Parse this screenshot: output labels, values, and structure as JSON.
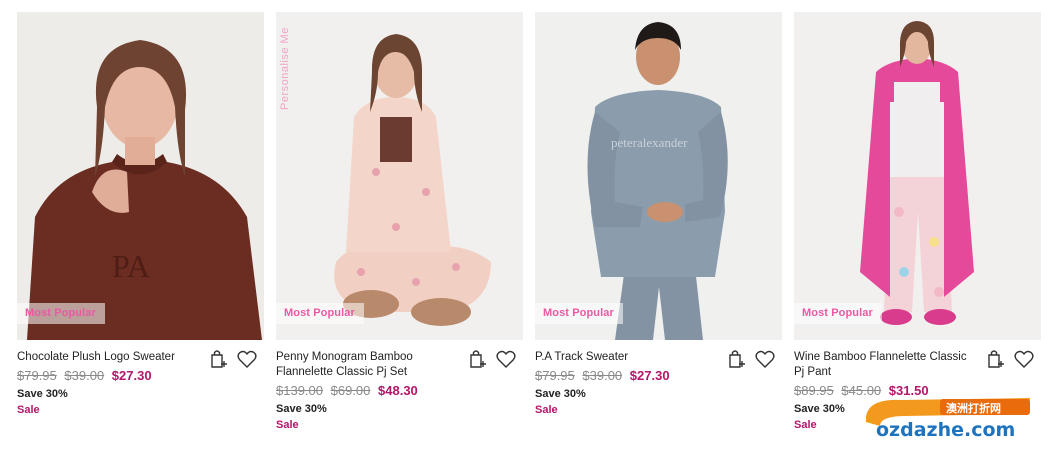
{
  "products": [
    {
      "name": "Chocolate Plush Logo Sweater",
      "badge": "Most Popular",
      "prices": {
        "original": "$79.95",
        "was": "$39.00",
        "now": "$27.30"
      },
      "save": "Save 30%",
      "sale": "Sale",
      "personalise": ""
    },
    {
      "name": "Penny Monogram Bamboo Flannelette Classic Pj Set",
      "badge": "Most Popular",
      "prices": {
        "original": "$139.00",
        "was": "$69.00",
        "now": "$48.30"
      },
      "save": "Save 30%",
      "sale": "Sale",
      "personalise": "Personalise Me"
    },
    {
      "name": "P.A Track Sweater",
      "badge": "Most Popular",
      "prices": {
        "original": "$79.95",
        "was": "$39.00",
        "now": "$27.30"
      },
      "save": "Save 30%",
      "sale": "Sale",
      "personalise": ""
    },
    {
      "name": "Wine Bamboo Flannelette Classic Pj Pant",
      "badge": "Most Popular",
      "prices": {
        "original": "$89.95",
        "was": "$45.00",
        "now": "$31.50"
      },
      "save": "Save 30%",
      "sale": "Sale",
      "personalise": ""
    }
  ],
  "watermark": {
    "cn_text": "澳洲打折网",
    "domain_text": "ozdazhe.com"
  },
  "colors": {
    "accent": "#b3166a",
    "badge": "#e85aa4",
    "personalise": "#f1a3c7"
  }
}
